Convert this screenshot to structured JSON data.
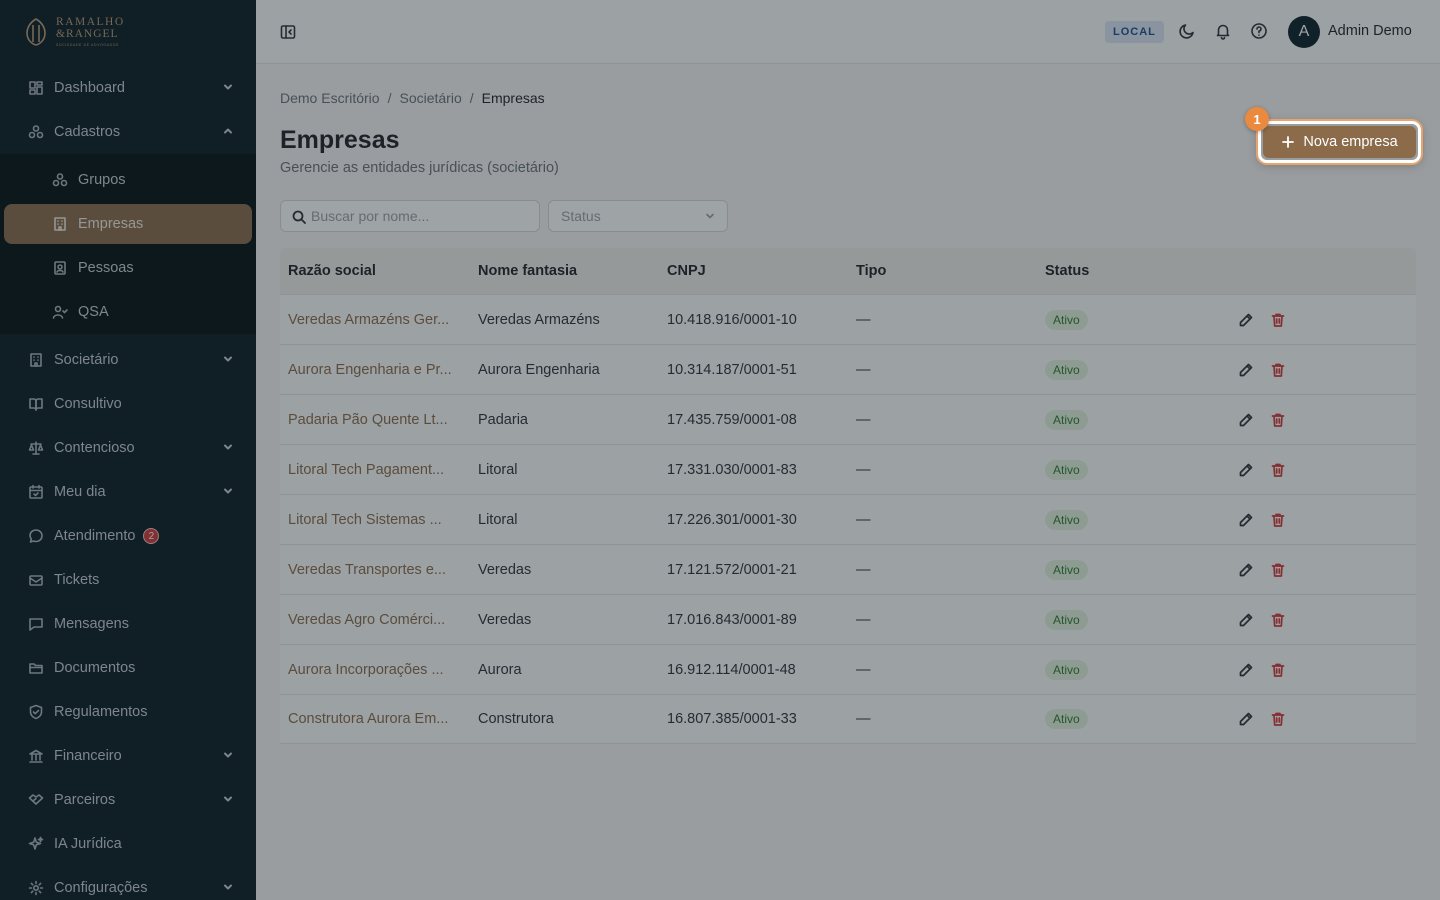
{
  "brand": {
    "line1": "RAMALHO",
    "line2": "&RANGEL",
    "line3": "SOCIEDADE DE ADVOGADOS"
  },
  "sidebar": {
    "items": [
      {
        "label": "Dashboard",
        "icon": "dashboard-icon",
        "chevron": "down"
      },
      {
        "label": "Cadastros",
        "icon": "cadastros-icon",
        "chevron": "up"
      },
      {
        "label": "Grupos",
        "icon": "grupos-icon"
      },
      {
        "label": "Empresas",
        "icon": "building-icon",
        "active": true
      },
      {
        "label": "Pessoas",
        "icon": "contact-icon"
      },
      {
        "label": "QSA",
        "icon": "user-check-icon"
      },
      {
        "label": "Societário",
        "icon": "building-icon",
        "chevron": "down"
      },
      {
        "label": "Consultivo",
        "icon": "book-icon"
      },
      {
        "label": "Contencioso",
        "icon": "scale-icon",
        "chevron": "down"
      },
      {
        "label": "Meu dia",
        "icon": "calendar-icon",
        "chevron": "down"
      },
      {
        "label": "Atendimento",
        "icon": "chat-icon",
        "badge": "2"
      },
      {
        "label": "Tickets",
        "icon": "ticket-icon"
      },
      {
        "label": "Mensagens",
        "icon": "message-icon"
      },
      {
        "label": "Documentos",
        "icon": "folder-icon"
      },
      {
        "label": "Regulamentos",
        "icon": "shield-icon"
      },
      {
        "label": "Financeiro",
        "icon": "bank-icon",
        "chevron": "down"
      },
      {
        "label": "Parceiros",
        "icon": "handshake-icon",
        "chevron": "down"
      },
      {
        "label": "IA Jurídica",
        "icon": "sparkles-icon"
      },
      {
        "label": "Configurações",
        "icon": "gear-icon",
        "chevron": "down"
      }
    ]
  },
  "header": {
    "env_badge": "LOCAL",
    "user_initial": "A",
    "user_name": "Admin Demo"
  },
  "breadcrumb": {
    "items": [
      "Demo Escritório",
      "Societário",
      "Empresas"
    ],
    "separator": "/"
  },
  "page": {
    "title": "Empresas",
    "subtitle": "Gerencie as entidades jurídicas (societário)",
    "new_button": "Nova empresa",
    "step_marker": "1"
  },
  "filters": {
    "search_placeholder": "Buscar por nome...",
    "status_placeholder": "Status"
  },
  "table": {
    "columns": [
      "Razão social",
      "Nome fantasia",
      "CNPJ",
      "Tipo",
      "Status"
    ],
    "rows": [
      {
        "razao": "Veredas Armazéns Ger...",
        "fantasia": "Veredas Armazéns",
        "cnpj": "10.418.916/0001-10",
        "tipo": "—",
        "status": "Ativo"
      },
      {
        "razao": "Aurora Engenharia e Pr...",
        "fantasia": "Aurora Engenharia",
        "cnpj": "10.314.187/0001-51",
        "tipo": "—",
        "status": "Ativo"
      },
      {
        "razao": "Padaria Pão Quente Lt...",
        "fantasia": "Padaria",
        "cnpj": "17.435.759/0001-08",
        "tipo": "—",
        "status": "Ativo"
      },
      {
        "razao": "Litoral Tech Pagament...",
        "fantasia": "Litoral",
        "cnpj": "17.331.030/0001-83",
        "tipo": "—",
        "status": "Ativo"
      },
      {
        "razao": "Litoral Tech Sistemas ...",
        "fantasia": "Litoral",
        "cnpj": "17.226.301/0001-30",
        "tipo": "—",
        "status": "Ativo"
      },
      {
        "razao": "Veredas Transportes e...",
        "fantasia": "Veredas",
        "cnpj": "17.121.572/0001-21",
        "tipo": "—",
        "status": "Ativo"
      },
      {
        "razao": "Veredas Agro Comérci...",
        "fantasia": "Veredas",
        "cnpj": "17.016.843/0001-89",
        "tipo": "—",
        "status": "Ativo"
      },
      {
        "razao": "Aurora Incorporações ...",
        "fantasia": "Aurora",
        "cnpj": "16.912.114/0001-48",
        "tipo": "—",
        "status": "Ativo"
      },
      {
        "razao": "Construtora Aurora Em...",
        "fantasia": "Construtora",
        "cnpj": "16.807.385/0001-33",
        "tipo": "—",
        "status": "Ativo"
      }
    ]
  },
  "colors": {
    "sidebar_bg": "#0b1a21",
    "accent": "#8b6b4a",
    "status_green": "#2f7a2a",
    "danger": "#d23a3a",
    "highlight": "#ea8a3f"
  }
}
